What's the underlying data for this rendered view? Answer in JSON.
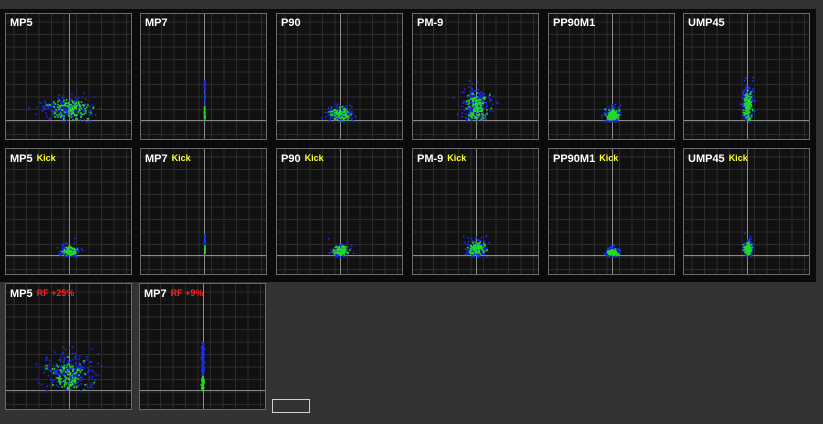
{
  "colors": {
    "background": "#333333",
    "panel_bg": "#111111",
    "panel_border": "#6a6a6a",
    "gridline": "#2c2c2c",
    "crosshair": "#8a8a8a",
    "hit_blue": "#1c2cf0",
    "hit_green": "#22dd22",
    "tag_kick": "#ffff33",
    "tag_rf": "#ff2222"
  },
  "panels": [
    {
      "name": "MP5",
      "tag": "",
      "tag_color": "",
      "pattern": "wide"
    },
    {
      "name": "MP7",
      "tag": "",
      "tag_color": "",
      "pattern": "line"
    },
    {
      "name": "P90",
      "tag": "",
      "tag_color": "",
      "pattern": "medium"
    },
    {
      "name": "PM-9",
      "tag": "",
      "tag_color": "",
      "pattern": "tall"
    },
    {
      "name": "PP90M1",
      "tag": "",
      "tag_color": "",
      "pattern": "cluster"
    },
    {
      "name": "UMP45",
      "tag": "",
      "tag_color": "",
      "pattern": "column"
    },
    {
      "name": "MP5",
      "tag": "Kick",
      "tag_color": "kick",
      "pattern": "kick-small"
    },
    {
      "name": "MP7",
      "tag": "Kick",
      "tag_color": "kick",
      "pattern": "line-short"
    },
    {
      "name": "P90",
      "tag": "Kick",
      "tag_color": "kick",
      "pattern": "kick-small"
    },
    {
      "name": "PM-9",
      "tag": "Kick",
      "tag_color": "kick",
      "pattern": "kick-tall"
    },
    {
      "name": "PP90M1",
      "tag": "Kick",
      "tag_color": "kick",
      "pattern": "kick-cluster"
    },
    {
      "name": "UMP45",
      "tag": "Kick",
      "tag_color": "kick",
      "pattern": "kick-column"
    },
    {
      "name": "MP5",
      "tag": "RF +25%",
      "tag_color": "rf",
      "pattern": "wide-tall"
    },
    {
      "name": "MP7",
      "tag": "RF +9%",
      "tag_color": "rf",
      "pattern": "line-thick"
    }
  ]
}
